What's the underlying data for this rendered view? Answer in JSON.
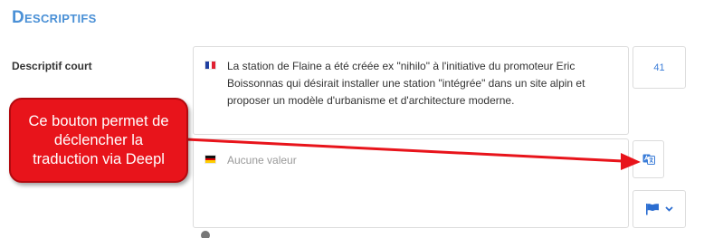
{
  "section": {
    "title": "Descriptifs"
  },
  "field": {
    "label": "Descriptif court"
  },
  "french": {
    "text": "La station de Flaine a été créée ex \"nihilo\" à l'initiative du promoteur Eric Boissonnas qui désirait installer une station \"intégrée\" dans un site alpin et proposer un modèle d'urbanisme et d'architecture moderne.",
    "char_count": "41",
    "flag_colors": [
      "#1f3fa0",
      "#ffffff",
      "#e02030"
    ]
  },
  "german": {
    "placeholder": "Aucune valeur",
    "flag_colors": [
      "#111111",
      "#dd0000",
      "#ffce00"
    ]
  },
  "buttons": {
    "translate_icon": "translate-icon",
    "language_icon": "flag-icon",
    "dropdown_icon": "chevron-down-icon"
  },
  "annotation": {
    "text": "Ce bouton permet de\ndéclencher la\ntraduction via Deepl",
    "color": "#e8141b"
  },
  "help_text": ""
}
